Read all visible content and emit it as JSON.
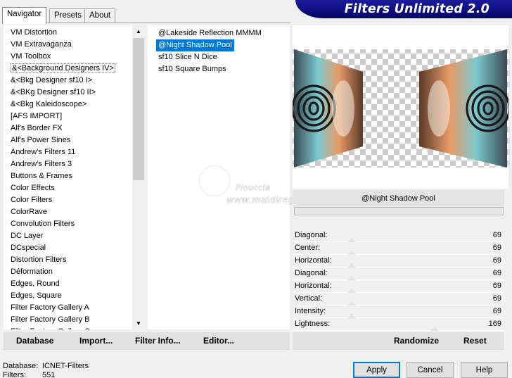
{
  "tabs": [
    {
      "label": "Navigator",
      "active": true
    },
    {
      "label": "Presets",
      "active": false
    },
    {
      "label": "About",
      "active": false
    }
  ],
  "banner": {
    "title": "Filters Unlimited 2.0",
    "color": "#0d0d7e"
  },
  "categories": {
    "items": [
      "VM Distortion",
      "VM Extravaganza",
      "VM Toolbox",
      "&<Background Designers IV>",
      "&<Bkg Designer sf10 I>",
      "&<BKg Designer sf10 II>",
      "&<Bkg Kaleidoscope>",
      "[AFS IMPORT]",
      "Alf's Border FX",
      "Alf's Power Sines",
      "Andrew's Filters 11",
      "Andrew's Filters 3",
      "Buttons & Frames",
      "Color Effects",
      "Color Filters",
      "ColorRave",
      "Convolution Filters",
      "DC Layer",
      "DCspecial",
      "Distortion Filters",
      "Déformation",
      "Edges, Round",
      "Edges, Square",
      "Filter Factory Gallery A",
      "Filter Factory Gallery B",
      "Filter Factory Gallery C"
    ],
    "selected_index": 3
  },
  "filters": {
    "items": [
      "@Lakeside Reflection MMMM",
      "@Night Shadow Pool",
      "sf10 Slice N Dice",
      "sf10 Square Bumps"
    ],
    "selected_index": 1,
    "highlight_color": "#0078d7"
  },
  "preview": {
    "current_filter": "@Night Shadow Pool"
  },
  "params": [
    {
      "label": "Diagonal:",
      "value": "69"
    },
    {
      "label": "Center:",
      "value": "69"
    },
    {
      "label": "Horizontal:",
      "value": "69"
    },
    {
      "label": "Diagonal:",
      "value": "69"
    },
    {
      "label": "Horizontal:",
      "value": "69"
    },
    {
      "label": "Vertical:",
      "value": "69"
    },
    {
      "label": "Intensity:",
      "value": "69"
    },
    {
      "label": "Lightness:",
      "value": "169"
    }
  ],
  "left_buttons": {
    "database": "Database",
    "import": "Import...",
    "filter_info": "Filter Info...",
    "editor": "Editor..."
  },
  "right_buttons": {
    "randomize": "Randomize",
    "reset": "Reset"
  },
  "info": {
    "database_label": "Database:",
    "database_value": "ICNET-Filters",
    "filters_label": "Filters:",
    "filters_value": "551"
  },
  "dialog": {
    "apply": "Apply",
    "cancel": "Cancel",
    "help": "Help"
  },
  "watermark": {
    "line1": "Pinuccia",
    "line2": "www.maidiregrafica.eu"
  }
}
